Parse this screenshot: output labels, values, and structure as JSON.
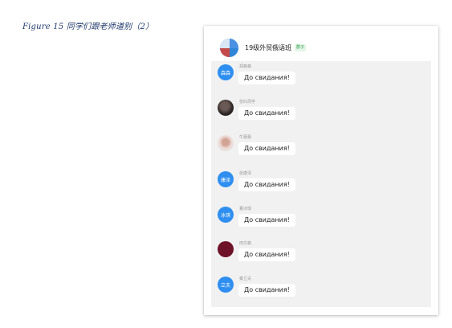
{
  "caption": "Figure 15 同学们跟老师道别（2）",
  "group": {
    "title": "19级外贸俄语班",
    "tag": "群子"
  },
  "messages": [
    {
      "name": "郑森森",
      "avatar_text": "森森",
      "text": "До свидания!"
    },
    {
      "name": "张红周学",
      "avatar_text": "",
      "text": "До свидания!"
    },
    {
      "name": "牛蕾蕾",
      "avatar_text": "",
      "text": "До свидания!"
    },
    {
      "name": "张康泽",
      "avatar_text": "康泽",
      "text": "До свидания!"
    },
    {
      "name": "董冰琪",
      "avatar_text": "冰琪",
      "text": "До свидания!"
    },
    {
      "name": "田文森",
      "avatar_text": "",
      "text": "До свидания!"
    },
    {
      "name": "秦立夫",
      "avatar_text": "立夫",
      "text": "До свидания!"
    }
  ]
}
